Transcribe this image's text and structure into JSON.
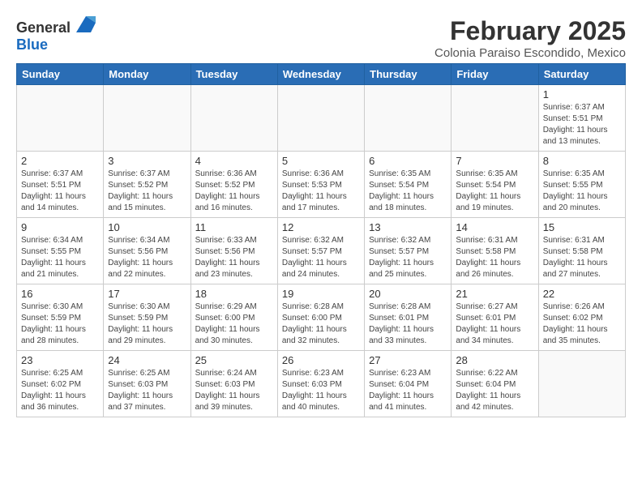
{
  "logo": {
    "general": "General",
    "blue": "Blue"
  },
  "title": "February 2025",
  "subtitle": "Colonia Paraiso Escondido, Mexico",
  "headers": [
    "Sunday",
    "Monday",
    "Tuesday",
    "Wednesday",
    "Thursday",
    "Friday",
    "Saturday"
  ],
  "weeks": [
    [
      {
        "day": "",
        "info": ""
      },
      {
        "day": "",
        "info": ""
      },
      {
        "day": "",
        "info": ""
      },
      {
        "day": "",
        "info": ""
      },
      {
        "day": "",
        "info": ""
      },
      {
        "day": "",
        "info": ""
      },
      {
        "day": "1",
        "info": "Sunrise: 6:37 AM\nSunset: 5:51 PM\nDaylight: 11 hours\nand 13 minutes."
      }
    ],
    [
      {
        "day": "2",
        "info": "Sunrise: 6:37 AM\nSunset: 5:51 PM\nDaylight: 11 hours\nand 14 minutes."
      },
      {
        "day": "3",
        "info": "Sunrise: 6:37 AM\nSunset: 5:52 PM\nDaylight: 11 hours\nand 15 minutes."
      },
      {
        "day": "4",
        "info": "Sunrise: 6:36 AM\nSunset: 5:52 PM\nDaylight: 11 hours\nand 16 minutes."
      },
      {
        "day": "5",
        "info": "Sunrise: 6:36 AM\nSunset: 5:53 PM\nDaylight: 11 hours\nand 17 minutes."
      },
      {
        "day": "6",
        "info": "Sunrise: 6:35 AM\nSunset: 5:54 PM\nDaylight: 11 hours\nand 18 minutes."
      },
      {
        "day": "7",
        "info": "Sunrise: 6:35 AM\nSunset: 5:54 PM\nDaylight: 11 hours\nand 19 minutes."
      },
      {
        "day": "8",
        "info": "Sunrise: 6:35 AM\nSunset: 5:55 PM\nDaylight: 11 hours\nand 20 minutes."
      }
    ],
    [
      {
        "day": "9",
        "info": "Sunrise: 6:34 AM\nSunset: 5:55 PM\nDaylight: 11 hours\nand 21 minutes."
      },
      {
        "day": "10",
        "info": "Sunrise: 6:34 AM\nSunset: 5:56 PM\nDaylight: 11 hours\nand 22 minutes."
      },
      {
        "day": "11",
        "info": "Sunrise: 6:33 AM\nSunset: 5:56 PM\nDaylight: 11 hours\nand 23 minutes."
      },
      {
        "day": "12",
        "info": "Sunrise: 6:32 AM\nSunset: 5:57 PM\nDaylight: 11 hours\nand 24 minutes."
      },
      {
        "day": "13",
        "info": "Sunrise: 6:32 AM\nSunset: 5:57 PM\nDaylight: 11 hours\nand 25 minutes."
      },
      {
        "day": "14",
        "info": "Sunrise: 6:31 AM\nSunset: 5:58 PM\nDaylight: 11 hours\nand 26 minutes."
      },
      {
        "day": "15",
        "info": "Sunrise: 6:31 AM\nSunset: 5:58 PM\nDaylight: 11 hours\nand 27 minutes."
      }
    ],
    [
      {
        "day": "16",
        "info": "Sunrise: 6:30 AM\nSunset: 5:59 PM\nDaylight: 11 hours\nand 28 minutes."
      },
      {
        "day": "17",
        "info": "Sunrise: 6:30 AM\nSunset: 5:59 PM\nDaylight: 11 hours\nand 29 minutes."
      },
      {
        "day": "18",
        "info": "Sunrise: 6:29 AM\nSunset: 6:00 PM\nDaylight: 11 hours\nand 30 minutes."
      },
      {
        "day": "19",
        "info": "Sunrise: 6:28 AM\nSunset: 6:00 PM\nDaylight: 11 hours\nand 32 minutes."
      },
      {
        "day": "20",
        "info": "Sunrise: 6:28 AM\nSunset: 6:01 PM\nDaylight: 11 hours\nand 33 minutes."
      },
      {
        "day": "21",
        "info": "Sunrise: 6:27 AM\nSunset: 6:01 PM\nDaylight: 11 hours\nand 34 minutes."
      },
      {
        "day": "22",
        "info": "Sunrise: 6:26 AM\nSunset: 6:02 PM\nDaylight: 11 hours\nand 35 minutes."
      }
    ],
    [
      {
        "day": "23",
        "info": "Sunrise: 6:25 AM\nSunset: 6:02 PM\nDaylight: 11 hours\nand 36 minutes."
      },
      {
        "day": "24",
        "info": "Sunrise: 6:25 AM\nSunset: 6:03 PM\nDaylight: 11 hours\nand 37 minutes."
      },
      {
        "day": "25",
        "info": "Sunrise: 6:24 AM\nSunset: 6:03 PM\nDaylight: 11 hours\nand 39 minutes."
      },
      {
        "day": "26",
        "info": "Sunrise: 6:23 AM\nSunset: 6:03 PM\nDaylight: 11 hours\nand 40 minutes."
      },
      {
        "day": "27",
        "info": "Sunrise: 6:23 AM\nSunset: 6:04 PM\nDaylight: 11 hours\nand 41 minutes."
      },
      {
        "day": "28",
        "info": "Sunrise: 6:22 AM\nSunset: 6:04 PM\nDaylight: 11 hours\nand 42 minutes."
      },
      {
        "day": "",
        "info": ""
      }
    ]
  ]
}
